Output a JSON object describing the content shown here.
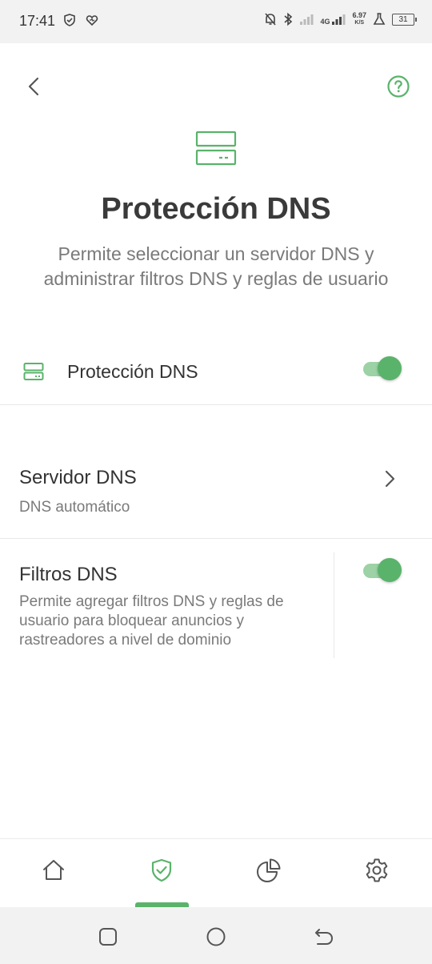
{
  "status_bar": {
    "time": "17:41",
    "network": "4G",
    "speed_value": "6.97",
    "speed_unit": "K/S",
    "battery": "31",
    "icons": [
      "shield-check-icon",
      "heart-icon",
      "mute-bell-icon",
      "bluetooth-icon",
      "signal-icon",
      "signal-4g-icon",
      "flask-icon",
      "battery-icon"
    ]
  },
  "header": {
    "back_icon": "chevron-left-icon",
    "help_icon": "help-circle-icon"
  },
  "hero": {
    "icon": "dns-server-icon",
    "title": "Protección DNS",
    "description": "Permite seleccionar un servidor DNS y administrar filtros DNS y reglas de usuario"
  },
  "main_toggle": {
    "icon": "dns-server-icon",
    "label": "Protección DNS",
    "enabled": true
  },
  "settings": {
    "server": {
      "title": "Servidor DNS",
      "subtitle": "DNS automático",
      "icon": "chevron-right-icon"
    },
    "filters": {
      "title": "Filtros DNS",
      "subtitle": "Permite agregar filtros DNS y reglas de usuario para bloquear anuncios y rastreadores a nivel de dominio",
      "enabled": true
    }
  },
  "bottom_nav": {
    "items": [
      {
        "icon": "home-icon",
        "active": false
      },
      {
        "icon": "shield-check-icon",
        "active": true
      },
      {
        "icon": "pie-chart-icon",
        "active": false
      },
      {
        "icon": "gear-icon",
        "active": false
      }
    ]
  },
  "colors": {
    "accent": "#5ab36b",
    "accent_light": "#9cd2a5",
    "text_primary": "#333333",
    "text_secondary": "#7a7a7a",
    "divider": "#e8e8e8"
  }
}
